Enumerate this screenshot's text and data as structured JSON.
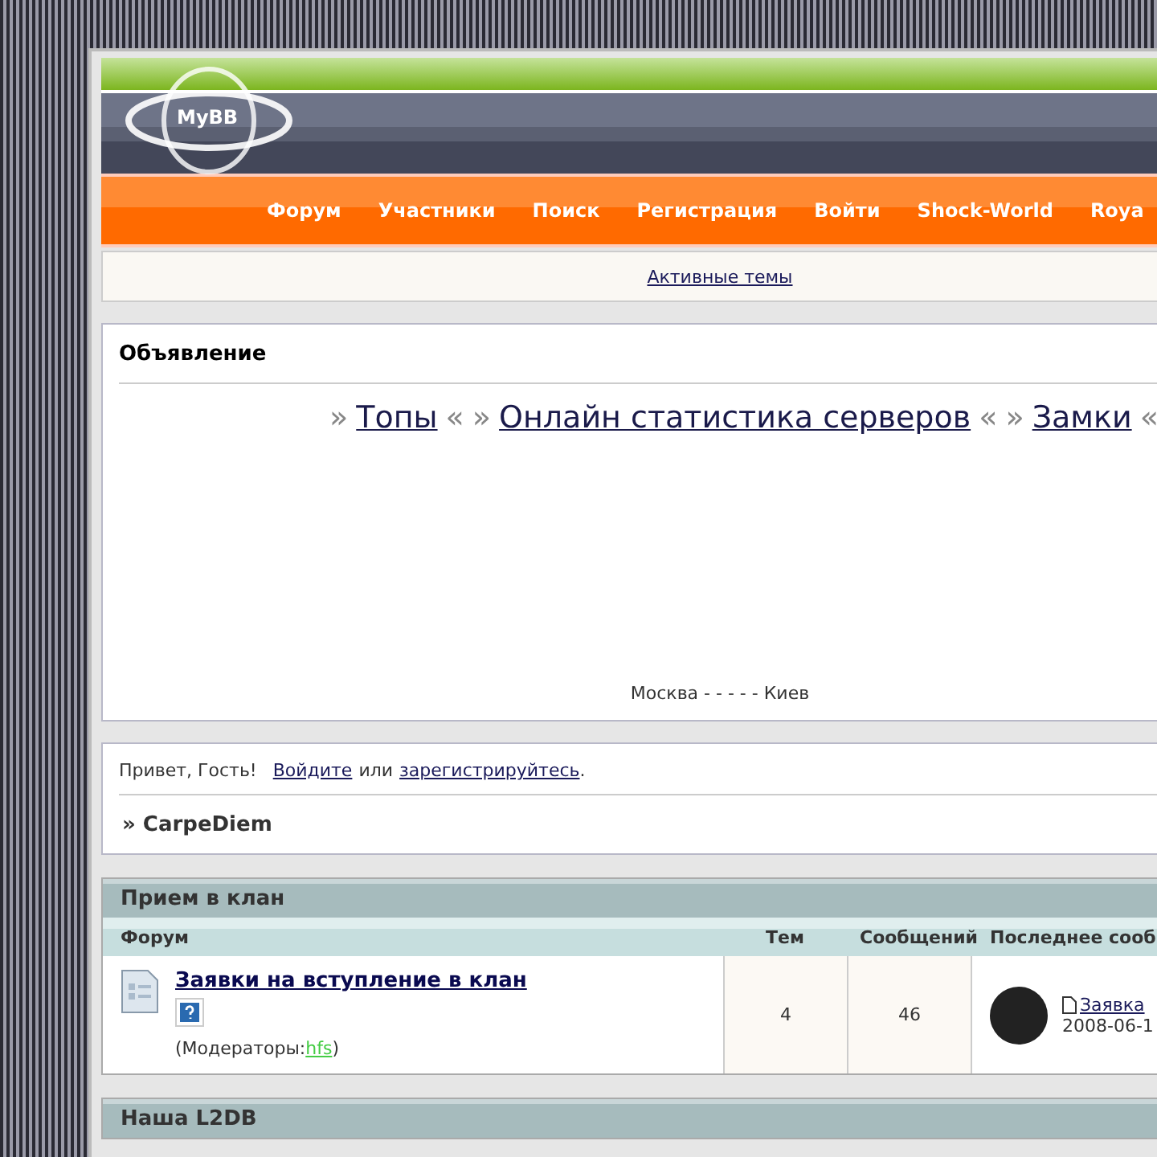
{
  "logo": "MyBB",
  "nav": [
    "Форум",
    "Участники",
    "Поиск",
    "Регистрация",
    "Войти",
    "Shock-World",
    "Roya"
  ],
  "subnav": {
    "link": "Активные темы"
  },
  "announcement": {
    "title": "Объявление",
    "links": [
      {
        "pre": "»",
        "label": "Топы",
        "post": "«"
      },
      {
        "pre": "»",
        "label": "Онлайн статистика серверов",
        "post": "«"
      },
      {
        "pre": "»",
        "label": "Замки",
        "post": "«"
      }
    ],
    "caption": "Москва - - - - - Киев"
  },
  "welcome": {
    "greeting": "Привет, Гость!",
    "login": "Войдите",
    "or": "или",
    "register": "зарегистрируйтесь",
    "end": ".",
    "breadcrumb": "» CarpeDiem"
  },
  "categories": [
    {
      "title": "Прием в клан",
      "columns": [
        "Форум",
        "Тем",
        "Сообщений",
        "Последнее сооб"
      ],
      "forums": [
        {
          "name": "Заявки на вступление в клан",
          "moderators_label": "(Модераторы:",
          "moderator": "hfs",
          "moderators_end": ")",
          "threads": "4",
          "posts": "46",
          "last_post": {
            "title": "Заявка",
            "date": "2008-06-1"
          }
        }
      ]
    },
    {
      "title": "Наша L2DB"
    }
  ]
}
